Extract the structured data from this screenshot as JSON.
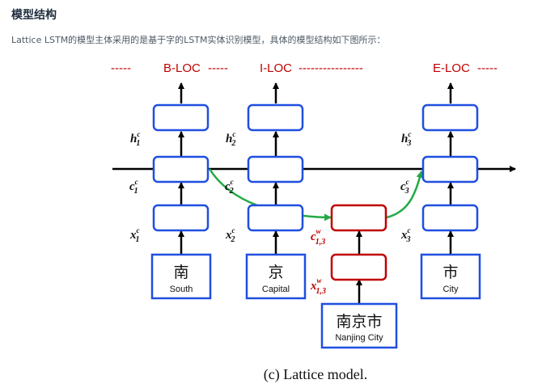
{
  "heading": "模型结构",
  "description": "Lattice LSTM的模型主体采用的是基于字的LSTM实体识别模型，具体的模型结构如下图所示：",
  "diagram": {
    "tags": [
      "B-LOC",
      "I-LOC",
      "E-LOC"
    ],
    "dashes": {
      "d1": "-----",
      "d2": "-----",
      "d3": "----------------",
      "d4": "-----"
    },
    "labels": {
      "h1": {
        "base": "h",
        "sub": "1",
        "sup": "c"
      },
      "h2": {
        "base": "h",
        "sub": "2",
        "sup": "c"
      },
      "h3": {
        "base": "h",
        "sub": "3",
        "sup": "c"
      },
      "c1": {
        "base": "c",
        "sub": "1",
        "sup": "c"
      },
      "c2": {
        "base": "c",
        "sub": "2",
        "sup": "c"
      },
      "c3": {
        "base": "c",
        "sub": "3",
        "sup": "c"
      },
      "x1": {
        "base": "x",
        "sub": "1",
        "sup": "c"
      },
      "x2": {
        "base": "x",
        "sub": "2",
        "sup": "c"
      },
      "x3": {
        "base": "x",
        "sub": "3",
        "sup": "c"
      },
      "cw": {
        "base": "c",
        "sub": "1,3",
        "sup": "w"
      },
      "xw": {
        "base": "x",
        "sub": "1,3",
        "sup": "w"
      }
    },
    "inputs": [
      {
        "zh": "南",
        "en": "South"
      },
      {
        "zh": "京",
        "en": "Capital"
      },
      {
        "zh": "市",
        "en": "City"
      }
    ],
    "word_input": {
      "zh": "南京市",
      "en": "Nanjing City"
    },
    "caption": "(c) Lattice model.",
    "colors": {
      "blue": "#1f4fe0",
      "red": "#c00000",
      "green": "#22aa44",
      "black": "#000000"
    }
  }
}
